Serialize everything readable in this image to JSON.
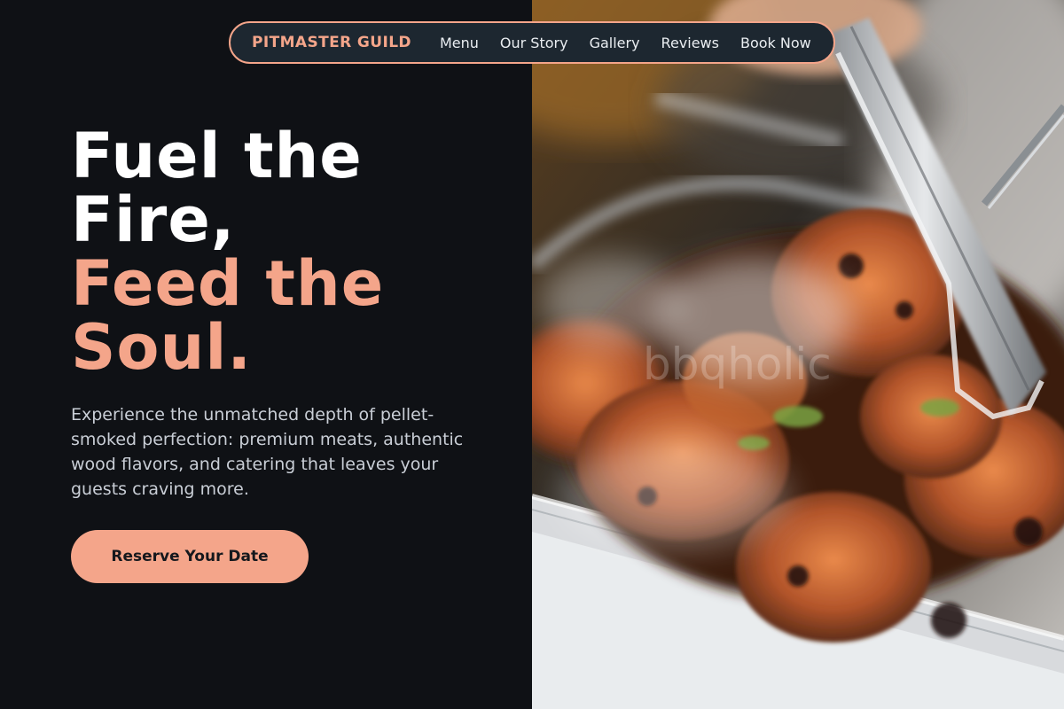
{
  "nav": {
    "brand": "PITMASTER GUILD",
    "links": [
      "Menu",
      "Our Story",
      "Gallery",
      "Reviews",
      "Book Now"
    ]
  },
  "hero": {
    "headline_line1": "Fuel the Fire,",
    "headline_line2": "Feed the Soul.",
    "description": "Experience the unmatched depth of pellet-smoked perfection: premium meats, authentic wood flavors, and catering that leaves your guests craving more.",
    "cta_label": "Reserve Your Date"
  },
  "photo": {
    "watermark": "bbqholic"
  },
  "colors": {
    "background": "#0f1115",
    "accent": "#f4a58a",
    "nav_background": "#1d2730",
    "headline": "#ffffff",
    "body_text": "#c9ced6"
  }
}
